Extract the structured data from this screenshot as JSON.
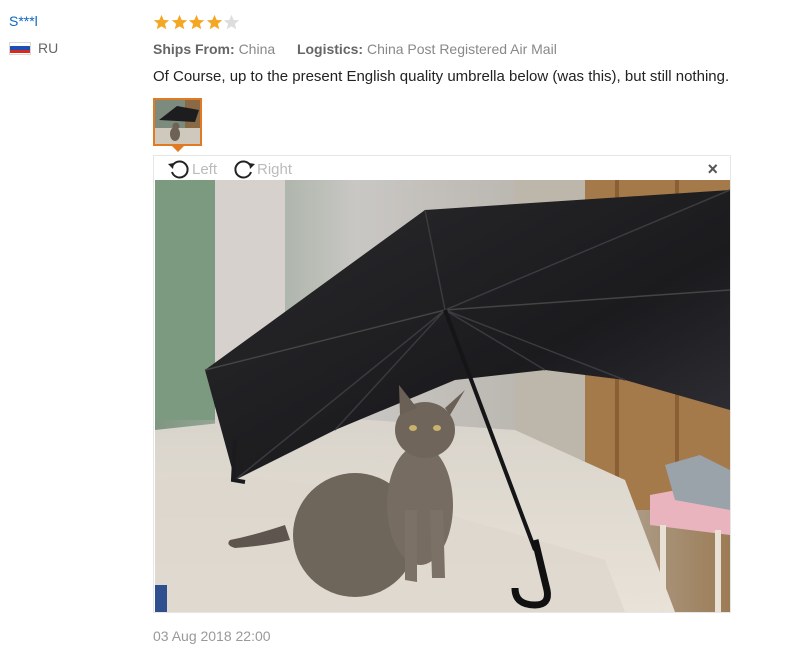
{
  "user": {
    "name": "S***l",
    "country": "RU"
  },
  "review": {
    "rating": 4,
    "rating_max": 5,
    "ships_from_label": "Ships From:",
    "ships_from_value": "China",
    "logistics_label": "Logistics:",
    "logistics_value": "China Post Registered Air Mail",
    "comment": "Of Course, up to the present English quality umbrella below (was this), but still nothing.",
    "date": "03 Aug 2018 22:00"
  },
  "viewer": {
    "rotate_left_label": "Left",
    "rotate_right_label": "Right",
    "close_label": "×"
  },
  "colors": {
    "username": "#0b67c2",
    "star_filled": "#f5a623",
    "star_empty": "#dddddd",
    "thumb_border": "#e07b24"
  },
  "icons": [
    "russia-flag-icon",
    "star-icon",
    "rotate-left-icon",
    "rotate-right-icon",
    "close-icon"
  ]
}
